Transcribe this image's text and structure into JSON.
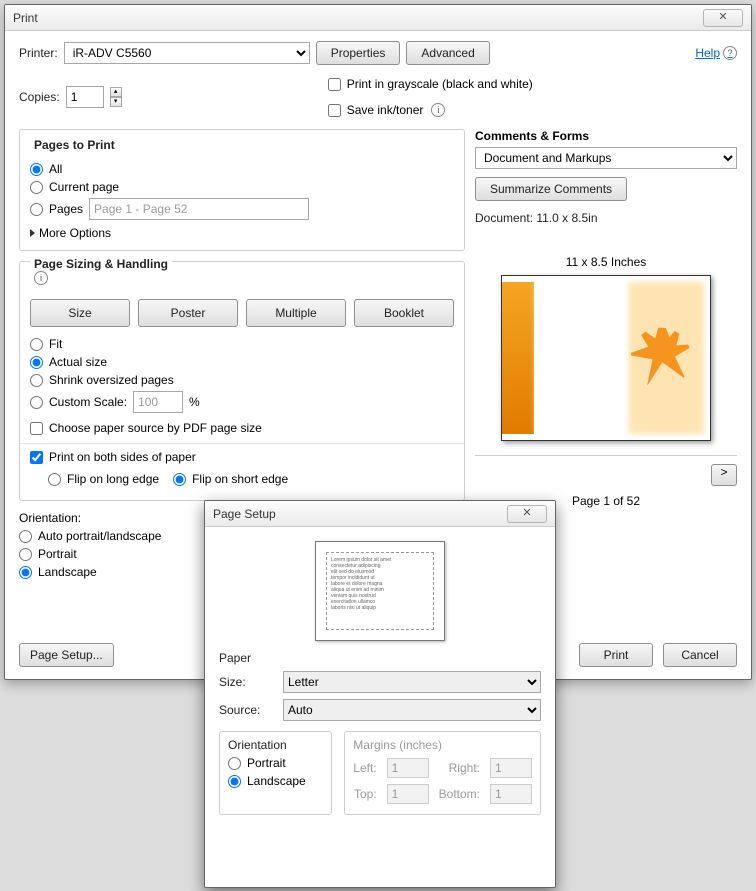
{
  "window": {
    "title": "Print",
    "close_glyph": "✕"
  },
  "help": {
    "label": "Help"
  },
  "printer": {
    "label": "Printer:",
    "value": "iR-ADV C5560"
  },
  "copies": {
    "label": "Copies:",
    "value": "1"
  },
  "buttons": {
    "properties": "Properties",
    "advanced": "Advanced",
    "summarize": "Summarize Comments",
    "page_setup": "Page Setup...",
    "print": "Print",
    "cancel": "Cancel"
  },
  "options": {
    "grayscale": "Print in grayscale (black and white)",
    "save_ink": "Save ink/toner"
  },
  "pages_to_print": {
    "legend": "Pages to Print",
    "all": "All",
    "current": "Current page",
    "pages": "Pages",
    "pages_value": "Page 1 - Page 52",
    "more": "More Options"
  },
  "sizing": {
    "legend": "Page Sizing & Handling",
    "size": "Size",
    "poster": "Poster",
    "multiple": "Multiple",
    "booklet": "Booklet",
    "fit": "Fit",
    "actual": "Actual size",
    "shrink": "Shrink oversized pages",
    "custom": "Custom Scale:",
    "custom_value": "100",
    "pct": "%",
    "choose_paper": "Choose paper source by PDF page size",
    "both_sides": "Print on both sides of paper",
    "flip_long": "Flip on long edge",
    "flip_short": "Flip on short edge"
  },
  "orientation": {
    "legend": "Orientation:",
    "auto": "Auto portrait/landscape",
    "portrait": "Portrait",
    "landscape": "Landscape"
  },
  "comments": {
    "legend": "Comments & Forms",
    "value": "Document and Markups"
  },
  "preview": {
    "doc_dim": "Document: 11.0 x 8.5in",
    "size_label": "11 x 8.5 Inches",
    "nav_next": ">",
    "nav_prev": "<",
    "page_of": "Page 1 of 52"
  },
  "page_setup": {
    "title": "Page Setup",
    "paper": "Paper",
    "size_label": "Size:",
    "size_value": "Letter",
    "source_label": "Source:",
    "source_value": "Auto",
    "orientation": "Orientation",
    "portrait": "Portrait",
    "landscape": "Landscape",
    "margins": "Margins (inches)",
    "left": "Left:",
    "right": "Right:",
    "top": "Top:",
    "bottom": "Bottom:",
    "margin_value": "1"
  }
}
